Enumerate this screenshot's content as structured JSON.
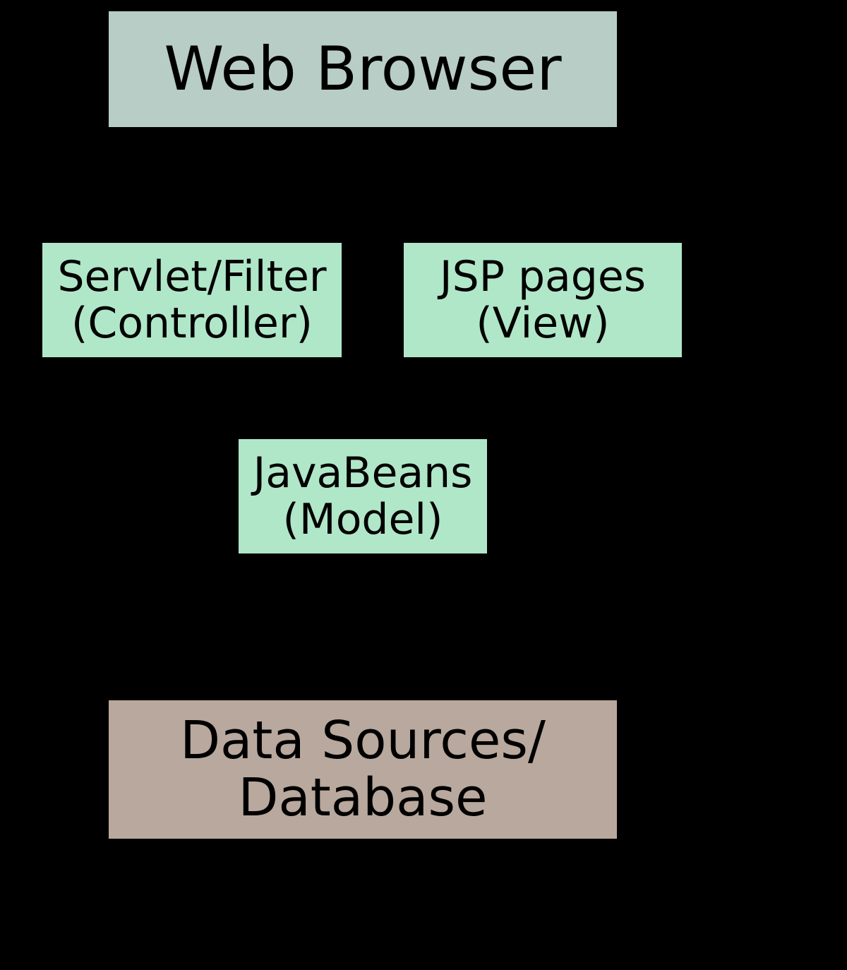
{
  "nodes": {
    "browser": {
      "label": "Web Browser"
    },
    "controller": {
      "line1": "Servlet/Filter",
      "line2": "(Controller)"
    },
    "view": {
      "line1": "JSP pages",
      "line2": "(View)"
    },
    "model": {
      "line1": "JavaBeans",
      "line2": "(Model)"
    },
    "db": {
      "line1": "Data Sources/",
      "line2": "Database"
    }
  },
  "edges": [
    {
      "from": "browser",
      "to": "controller",
      "bidirectional": false
    },
    {
      "from": "view",
      "to": "browser",
      "bidirectional": false
    },
    {
      "from": "controller",
      "to": "view",
      "bidirectional": false
    },
    {
      "from": "controller",
      "to": "model",
      "bidirectional": true
    },
    {
      "from": "model",
      "to": "view",
      "bidirectional": false
    },
    {
      "from": "model",
      "to": "db",
      "bidirectional": true
    }
  ],
  "colors": {
    "browser_box": "#b7cdc6",
    "mvc_box": "#b0e7c9",
    "db_box": "#b9a89d",
    "background": "#000000"
  }
}
